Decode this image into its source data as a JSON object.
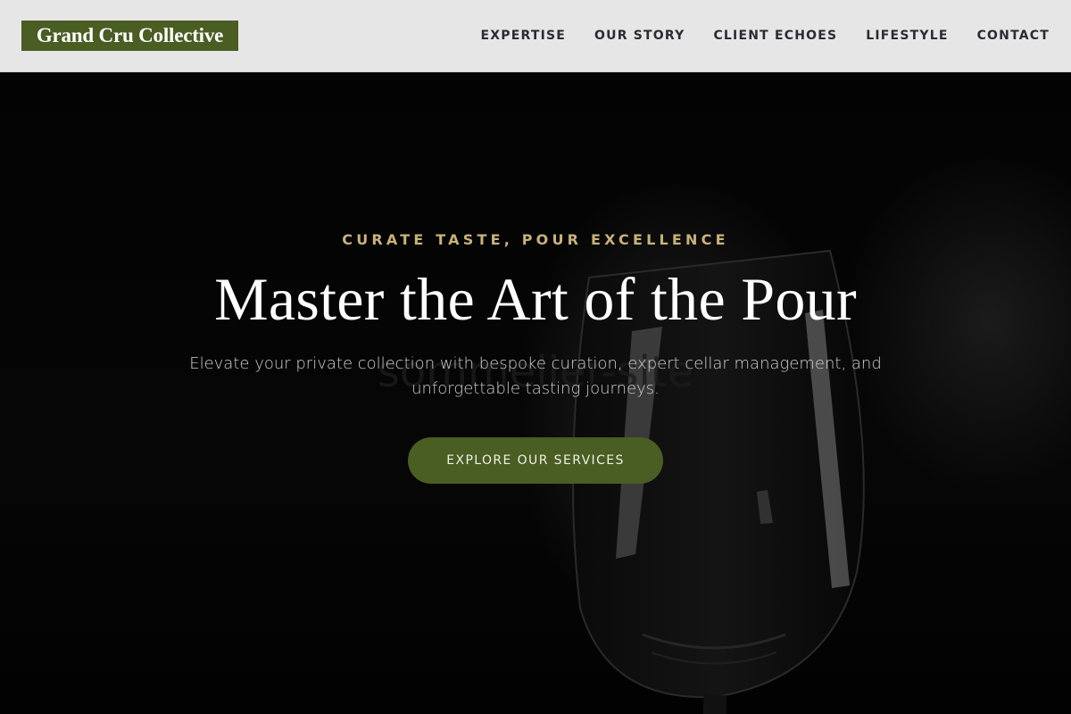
{
  "brand": {
    "name": "Grand Cru Collective",
    "accent_color": "#4a5d23"
  },
  "nav": {
    "items": [
      {
        "label": "EXPERTISE"
      },
      {
        "label": "OUR STORY"
      },
      {
        "label": "CLIENT ECHOES"
      },
      {
        "label": "LIFESTYLE"
      },
      {
        "label": "CONTACT"
      }
    ]
  },
  "hero": {
    "tagline": "CURATE TASTE, POUR EXCELLENCE",
    "headline": "Master the Art of the Pour",
    "subtitle": "Elevate your private collection with bespoke curation, expert cellar management, and unforgettable tasting journeys.",
    "cta_label": "EXPLORE OUR SERVICES",
    "tagline_color": "#c9b27a",
    "background_image": "wine-glass-photo"
  }
}
